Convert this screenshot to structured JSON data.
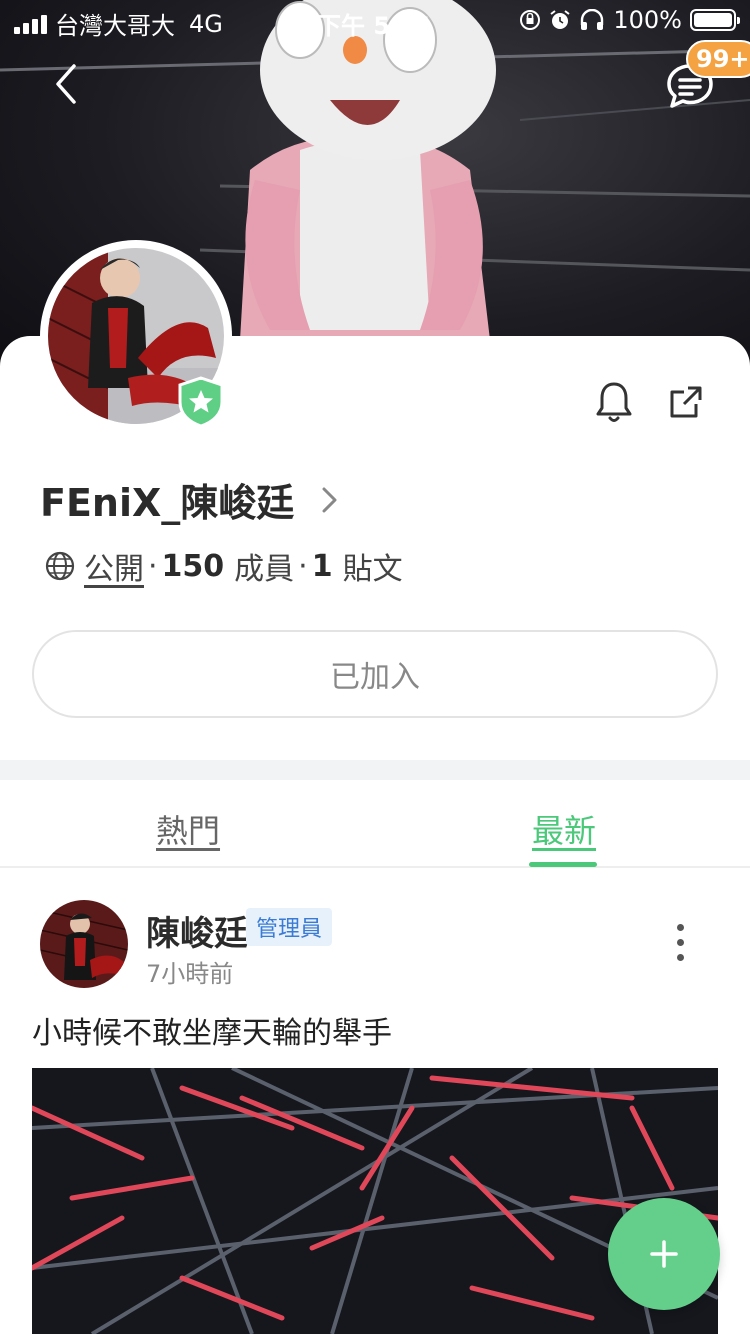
{
  "status_bar": {
    "carrier": "台灣大哥大",
    "network": "4G",
    "time": "下午 5:51",
    "battery": "100%"
  },
  "header": {
    "notification_badge": "99+"
  },
  "group": {
    "name": "FEniX_陳峻廷",
    "visibility": "公開",
    "members_count": "150",
    "members_label": "成員",
    "posts_count": "1",
    "posts_label": "貼文",
    "separator": "·",
    "join_status": "已加入"
  },
  "tabs": [
    {
      "label": "熱門",
      "active": false
    },
    {
      "label": "最新",
      "active": true
    }
  ],
  "post": {
    "author": "陳峻廷",
    "role_tag": "管理員",
    "time": "7小時前",
    "text": "小時候不敢坐摩天輪的舉手"
  },
  "colors": {
    "accent": "#4cc87a",
    "fab": "#63cf8a",
    "badge": "#f5a342",
    "admin_tag_text": "#3a7bd5"
  },
  "icons": {
    "back": "chevron-left-icon",
    "chat": "chat-bubble-icon",
    "bell": "bell-icon",
    "share": "share-icon",
    "globe": "globe-icon",
    "more": "more-vertical-icon",
    "add": "plus-icon",
    "verified": "shield-star-icon"
  }
}
